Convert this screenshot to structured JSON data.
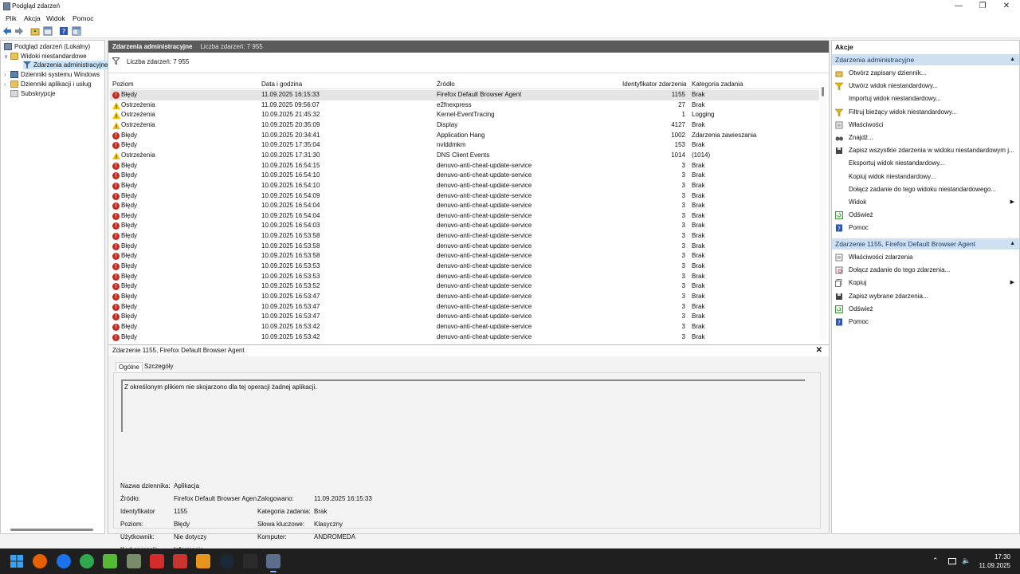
{
  "window": {
    "title": "Podgląd zdarzeń"
  },
  "menu": [
    "Plik",
    "Akcja",
    "Widok",
    "Pomoc"
  ],
  "tree": {
    "root": "Podgląd zdarzeń (Lokalny)",
    "custom_views": "Widoki niestandardowe",
    "admin_events": "Zdarzenia administracyjne",
    "windows_logs": "Dzienniki systemu Windows",
    "app_logs": "Dzienniki aplikacji i usług",
    "subscriptions": "Subskrypcje"
  },
  "center": {
    "header_title": "Zdarzenia administracyjne",
    "header_count": "Liczba zdarzeń: 7 955",
    "filter_count": "Liczba zdarzeń: 7 955",
    "columns": [
      "Poziom",
      "Data i godzina",
      "Źródło",
      "Identyfikator zdarzenia",
      "Kategoria zadania"
    ],
    "rows": [
      {
        "level": "Błędy",
        "type": "error",
        "date": "11.09.2025 16:15:33",
        "source": "Firefox Default Browser Agent",
        "id": "1155",
        "category": "Brak"
      },
      {
        "level": "Ostrzeżenia",
        "type": "warning",
        "date": "11.09.2025 09:56:07",
        "source": "e2fnexpress",
        "id": "27",
        "category": "Brak"
      },
      {
        "level": "Ostrzeżenia",
        "type": "warning",
        "date": "10.09.2025 21:45:32",
        "source": "Kernel-EventTracing",
        "id": "1",
        "category": "Logging"
      },
      {
        "level": "Ostrzeżenia",
        "type": "warning",
        "date": "10.09.2025 20:35:09",
        "source": "Display",
        "id": "4127",
        "category": "Brak"
      },
      {
        "level": "Błędy",
        "type": "error",
        "date": "10.09.2025 20:34:41",
        "source": "Application Hang",
        "id": "1002",
        "category": "Zdarzenia zawieszania"
      },
      {
        "level": "Błędy",
        "type": "error",
        "date": "10.09.2025 17:35:04",
        "source": "nvlddmkm",
        "id": "153",
        "category": "Brak"
      },
      {
        "level": "Ostrzeżenia",
        "type": "warning",
        "date": "10.09.2025 17:31:30",
        "source": "DNS Client Events",
        "id": "1014",
        "category": "(1014)"
      },
      {
        "level": "Błędy",
        "type": "error",
        "date": "10.09.2025 16:54:15",
        "source": "denuvo-anti-cheat-update-service",
        "id": "3",
        "category": "Brak"
      },
      {
        "level": "Błędy",
        "type": "error",
        "date": "10.09.2025 16:54:10",
        "source": "denuvo-anti-cheat-update-service",
        "id": "3",
        "category": "Brak"
      },
      {
        "level": "Błędy",
        "type": "error",
        "date": "10.09.2025 16:54:10",
        "source": "denuvo-anti-cheat-update-service",
        "id": "3",
        "category": "Brak"
      },
      {
        "level": "Błędy",
        "type": "error",
        "date": "10.09.2025 16:54:09",
        "source": "denuvo-anti-cheat-update-service",
        "id": "3",
        "category": "Brak"
      },
      {
        "level": "Błędy",
        "type": "error",
        "date": "10.09.2025 16:54:04",
        "source": "denuvo-anti-cheat-update-service",
        "id": "3",
        "category": "Brak"
      },
      {
        "level": "Błędy",
        "type": "error",
        "date": "10.09.2025 16:54:04",
        "source": "denuvo-anti-cheat-update-service",
        "id": "3",
        "category": "Brak"
      },
      {
        "level": "Błędy",
        "type": "error",
        "date": "10.09.2025 16:54:03",
        "source": "denuvo-anti-cheat-update-service",
        "id": "3",
        "category": "Brak"
      },
      {
        "level": "Błędy",
        "type": "error",
        "date": "10.09.2025 16:53:58",
        "source": "denuvo-anti-cheat-update-service",
        "id": "3",
        "category": "Brak"
      },
      {
        "level": "Błędy",
        "type": "error",
        "date": "10.09.2025 16:53:58",
        "source": "denuvo-anti-cheat-update-service",
        "id": "3",
        "category": "Brak"
      },
      {
        "level": "Błędy",
        "type": "error",
        "date": "10.09.2025 16:53:58",
        "source": "denuvo-anti-cheat-update-service",
        "id": "3",
        "category": "Brak"
      },
      {
        "level": "Błędy",
        "type": "error",
        "date": "10.09.2025 16:53:53",
        "source": "denuvo-anti-cheat-update-service",
        "id": "3",
        "category": "Brak"
      },
      {
        "level": "Błędy",
        "type": "error",
        "date": "10.09.2025 16:53:53",
        "source": "denuvo-anti-cheat-update-service",
        "id": "3",
        "category": "Brak"
      },
      {
        "level": "Błędy",
        "type": "error",
        "date": "10.09.2025 16:53:52",
        "source": "denuvo-anti-cheat-update-service",
        "id": "3",
        "category": "Brak"
      },
      {
        "level": "Błędy",
        "type": "error",
        "date": "10.09.2025 16:53:47",
        "source": "denuvo-anti-cheat-update-service",
        "id": "3",
        "category": "Brak"
      },
      {
        "level": "Błędy",
        "type": "error",
        "date": "10.09.2025 16:53:47",
        "source": "denuvo-anti-cheat-update-service",
        "id": "3",
        "category": "Brak"
      },
      {
        "level": "Błędy",
        "type": "error",
        "date": "10.09.2025 16:53:47",
        "source": "denuvo-anti-cheat-update-service",
        "id": "3",
        "category": "Brak"
      },
      {
        "level": "Błędy",
        "type": "error",
        "date": "10.09.2025 16:53:42",
        "source": "denuvo-anti-cheat-update-service",
        "id": "3",
        "category": "Brak"
      },
      {
        "level": "Błędy",
        "type": "error",
        "date": "10.09.2025 16:53:42",
        "source": "denuvo-anti-cheat-update-service",
        "id": "3",
        "category": "Brak"
      }
    ]
  },
  "detail": {
    "title": "Zdarzenie 1155, Firefox Default Browser Agent",
    "tabs": [
      "Ogólne",
      "Szczegóły"
    ],
    "message": "Z określonym plikiem nie skojarzono dla tej operacji żadnej aplikacji.",
    "fields": {
      "log_name_label": "Nazwa dziennika:",
      "log_name": "Aplikacja",
      "source_label": "Źródło:",
      "source": "Firefox Default Browser Agen",
      "logged_label": "Zalogowano:",
      "logged": "11.09.2025 16:15:33",
      "id_label": "Identyfikator",
      "id": "1155",
      "task_label": "Kategoria zadania:",
      "task": "Brak",
      "level_label": "Poziom:",
      "level": "Błędy",
      "keywords_label": "Słowa kluczowe:",
      "keywords": "Klasyczny",
      "user_label": "Użytkownik:",
      "user": "Nie dotyczy",
      "computer_label": "Komputer:",
      "computer": "ANDROMEDA",
      "opcode_label": "Kod operacji:",
      "opcode": "Informacje"
    }
  },
  "actions": {
    "title": "Akcje",
    "section1": "Zdarzenia administracyjne",
    "items1": [
      {
        "label": "Otwórz zapisany dziennik...",
        "icon": "open-folder-icon"
      },
      {
        "label": "Utwórz widok niestandardowy...",
        "icon": "filter-icon"
      },
      {
        "label": "Importuj widok niestandardowy...",
        "icon": ""
      },
      {
        "label": "Filtruj bieżący widok niestandardowy...",
        "icon": "filter-icon"
      },
      {
        "label": "Właściwości",
        "icon": "properties-icon"
      },
      {
        "label": "Znajdź...",
        "icon": "binoculars-icon"
      },
      {
        "label": "Zapisz wszystkie zdarzenia w widoku niestandardowym j...",
        "icon": "save-icon"
      },
      {
        "label": "Eksportuj widok niestandardowy...",
        "icon": ""
      },
      {
        "label": "Kopiuj widok niestandardowy...",
        "icon": ""
      },
      {
        "label": "Dołącz zadanie do tego widoku niestandardowego...",
        "icon": ""
      },
      {
        "label": "Widok",
        "icon": "",
        "submenu": true
      },
      {
        "label": "Odśwież",
        "icon": "refresh-icon"
      },
      {
        "label": "Pomoc",
        "icon": "help-icon"
      }
    ],
    "section2": "Zdarzenie 1155, Firefox Default Browser Agent",
    "items2": [
      {
        "label": "Właściwości zdarzenia",
        "icon": "properties-icon"
      },
      {
        "label": "Dołącz zadanie do tego zdarzenia...",
        "icon": "task-icon"
      },
      {
        "label": "Kopiuj",
        "icon": "copy-icon",
        "submenu": true
      },
      {
        "label": "Zapisz wybrane zdarzenia...",
        "icon": "save-icon"
      },
      {
        "label": "Odśwież",
        "icon": "refresh-icon"
      },
      {
        "label": "Pomoc",
        "icon": "help-icon"
      }
    ]
  },
  "taskbar": {
    "time": "17:30",
    "date": "11.09.2025",
    "apps": [
      "start-icon",
      "firefox-icon",
      "app-blue-icon",
      "app-green-icon",
      "app-lime-icon",
      "explorer-icon",
      "app-red-icon",
      "app-64-icon",
      "app-orange-icon",
      "steam-icon",
      "app-dark-icon",
      "event-viewer-icon"
    ]
  }
}
